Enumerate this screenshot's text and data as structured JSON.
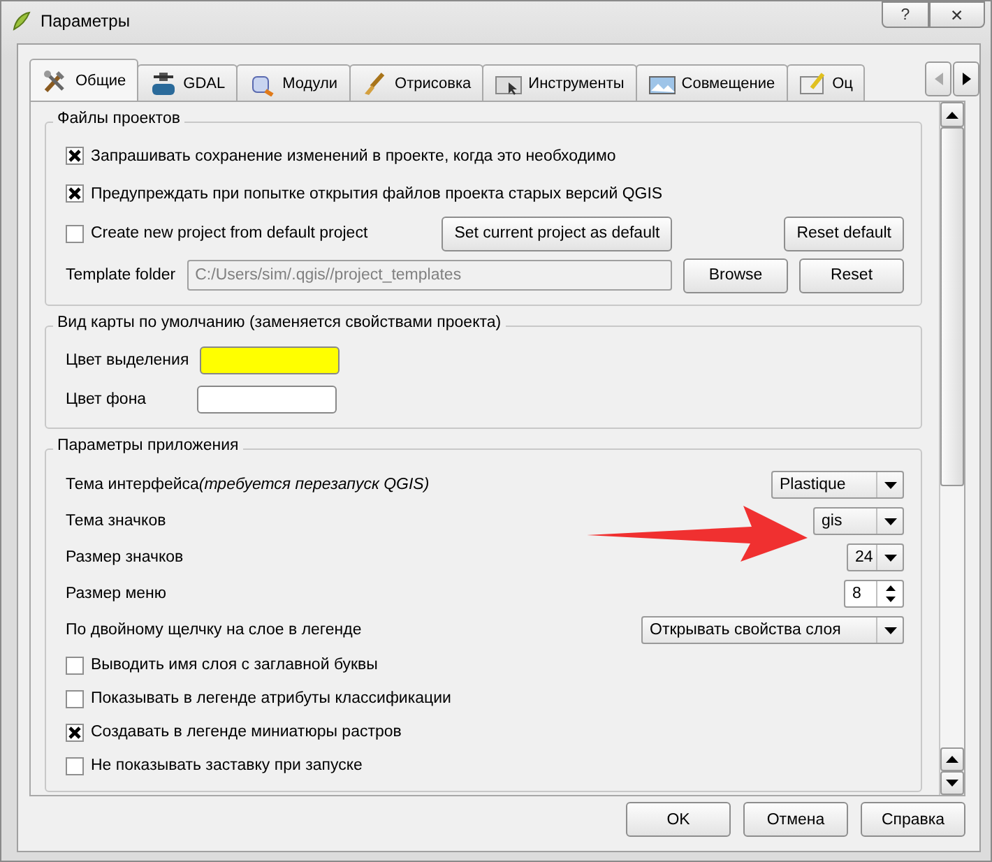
{
  "window": {
    "title": "Параметры",
    "help_button": "?",
    "close_button": "✕"
  },
  "tabs": [
    {
      "label": "Общие",
      "selected": true
    },
    {
      "label": "GDAL",
      "selected": false
    },
    {
      "label": "Модули",
      "selected": false
    },
    {
      "label": "Отрисовка",
      "selected": false
    },
    {
      "label": "Инструменты",
      "selected": false
    },
    {
      "label": "Совмещение",
      "selected": false
    },
    {
      "label": "Оц",
      "selected": false
    }
  ],
  "project_files": {
    "title": "Файлы проектов",
    "checkboxes": [
      {
        "label": "Запрашивать сохранение изменений в проекте, когда это необходимо",
        "checked": true
      },
      {
        "label": "Предупреждать при попытке открытия файлов проекта старых версий QGIS",
        "checked": true
      }
    ],
    "default_project": {
      "label": "Create new project from default project",
      "checked": false,
      "set_button": "Set current project as default",
      "reset_button": "Reset default"
    },
    "template_folder": {
      "label": "Template folder",
      "value": "C:/Users/sim/.qgis//project_templates",
      "browse_button": "Browse",
      "reset_button": "Reset"
    }
  },
  "map_view": {
    "title": "Вид карты по умолчанию (заменяется свойствами проекта)",
    "colors": [
      {
        "label": "Цвет выделения",
        "color": "#ffff00"
      },
      {
        "label": "Цвет фона",
        "color": "#ffffff"
      }
    ]
  },
  "application": {
    "title": "Параметры приложения",
    "settings": [
      {
        "kind": "combo",
        "label": "Тема интерфейса",
        "note": "(требуется перезапуск QGIS)",
        "value": "Plastique"
      },
      {
        "kind": "combo",
        "label": "Тема значков",
        "value": "gis"
      },
      {
        "kind": "combo",
        "label": "Размер значков",
        "value": "24"
      },
      {
        "kind": "spin",
        "label": "Размер меню",
        "value": "8"
      },
      {
        "kind": "combo",
        "label": "По двойному щелчку на слое в легенде",
        "value": "Открывать свойства слоя"
      }
    ],
    "checkboxes": [
      {
        "label": "Выводить имя слоя с заглавной буквы",
        "checked": false
      },
      {
        "label": "Показывать в легенде атрибуты классификации",
        "checked": false
      },
      {
        "label": "Создавать в легенде миниатюры растров",
        "checked": true
      },
      {
        "label": "Не показывать заставку при запуске",
        "checked": false
      }
    ]
  },
  "buttons": [
    "OK",
    "Отмена",
    "Справка"
  ]
}
